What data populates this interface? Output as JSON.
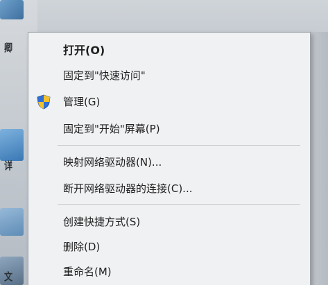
{
  "desktop": {
    "labels": [
      "卿",
      "详",
      "文"
    ]
  },
  "context_menu": {
    "items": [
      {
        "label": "打开(O)",
        "bold": true
      },
      {
        "label": "固定到\"快速访问\""
      },
      {
        "label": "管理(G)",
        "icon": "uac-shield-icon"
      },
      {
        "label": "固定到\"开始\"屏幕(P)"
      },
      {
        "label": "映射网络驱动器(N)..."
      },
      {
        "label": "断开网络驱动器的连接(C)..."
      },
      {
        "label": "创建快捷方式(S)"
      },
      {
        "label": "删除(D)"
      },
      {
        "label": "重命名(M)"
      }
    ]
  },
  "colors": {
    "menu_background": "#f0f1f3",
    "menu_text": "#1f1f1f",
    "separator": "#c5c8cc",
    "shield_blue": "#2f6fd6",
    "shield_yellow": "#f2c12e"
  }
}
